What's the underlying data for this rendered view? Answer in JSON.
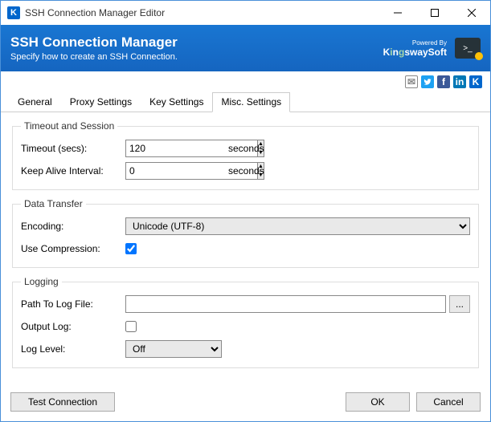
{
  "window": {
    "title": "SSH Connection Manager Editor"
  },
  "banner": {
    "title": "SSH Connection Manager",
    "subtitle": "Specify how to create an SSH Connection.",
    "powered_by": "Powered By",
    "brand": "KingswaySoft"
  },
  "tabs": {
    "general": "General",
    "proxy": "Proxy Settings",
    "key": "Key Settings",
    "misc": "Misc. Settings"
  },
  "groups": {
    "timeout": {
      "legend": "Timeout and Session",
      "timeout_label": "Timeout (secs):",
      "timeout_value": "120",
      "timeout_unit": "seconds",
      "keepalive_label": "Keep Alive Interval:",
      "keepalive_value": "0",
      "keepalive_unit": "seconds"
    },
    "transfer": {
      "legend": "Data Transfer",
      "encoding_label": "Encoding:",
      "encoding_value": "Unicode (UTF-8)",
      "compression_label": "Use Compression:",
      "compression_checked": true
    },
    "logging": {
      "legend": "Logging",
      "path_label": "Path To Log File:",
      "path_value": "",
      "browse_label": "...",
      "output_label": "Output Log:",
      "output_checked": false,
      "level_label": "Log Level:",
      "level_value": "Off"
    }
  },
  "footer": {
    "test": "Test Connection",
    "ok": "OK",
    "cancel": "Cancel"
  }
}
